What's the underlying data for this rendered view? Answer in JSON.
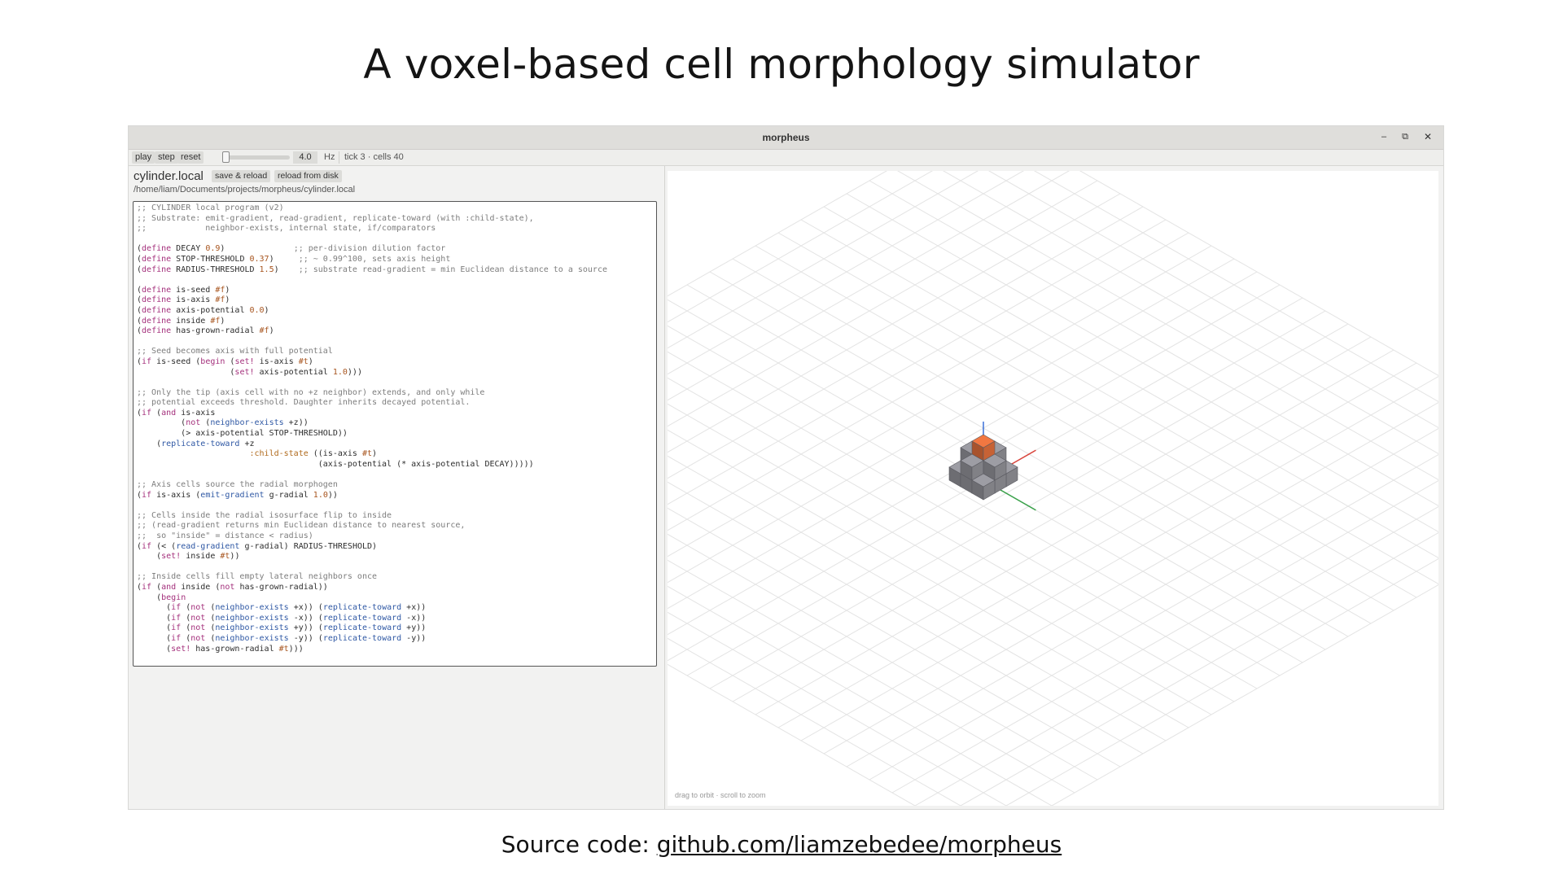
{
  "slide": {
    "title": "A voxel-based cell morphology simulator",
    "source_prefix": "Source code: ",
    "source_link": "github.com/liamzebedee/morpheus"
  },
  "window": {
    "title": "morpheus",
    "controls": {
      "minimize": "–",
      "maximize": "⧉",
      "close": "✕"
    }
  },
  "toolbar": {
    "play": "play",
    "step": "step",
    "reset": "reset",
    "rate_value": "4.0",
    "rate_unit": "Hz",
    "status": "tick 3 · cells 40"
  },
  "editor": {
    "file_name": "cylinder.local",
    "save_reload": "save & reload",
    "reload_disk": "reload from disk",
    "path": "/home/liam/Documents/projects/morpheus/cylinder.local"
  },
  "viewport": {
    "hint": "drag to orbit · scroll to zoom",
    "colors": {
      "voxel": "#8c8c92",
      "seed_voxel": "#d86a3a",
      "axis_x": "#d9453d",
      "axis_y": "#3aa14a",
      "axis_z": "#3a6fd8",
      "grid": "#e3e3e3"
    }
  }
}
